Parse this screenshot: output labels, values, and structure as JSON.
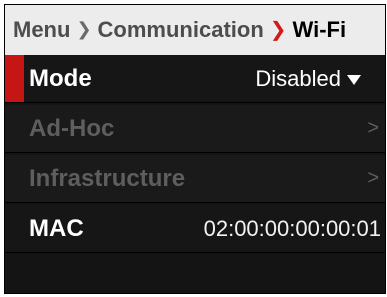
{
  "breadcrumb": {
    "root": "Menu",
    "parent": "Communication",
    "current": "Wi-Fi"
  },
  "rows": {
    "mode": {
      "label": "Mode",
      "value": "Disabled"
    },
    "adhoc": {
      "label": "Ad-Hoc",
      "chevron": ">"
    },
    "infrastructure": {
      "label": "Infrastructure",
      "chevron": ">"
    },
    "mac": {
      "label": "MAC",
      "value": "02:00:00:00:00:01"
    }
  },
  "icons": {
    "breadcrumb_sep": "chevron-right-icon",
    "current_sep": "chevron-right-red-icon",
    "dropdown": "caret-down-icon",
    "row_chevron": "chevron-right-icon"
  },
  "colors": {
    "accent": "#c61515",
    "background": "#141414",
    "header_bg": "#ececec",
    "disabled_text": "#5e5e5e",
    "text": "#ffffff"
  }
}
